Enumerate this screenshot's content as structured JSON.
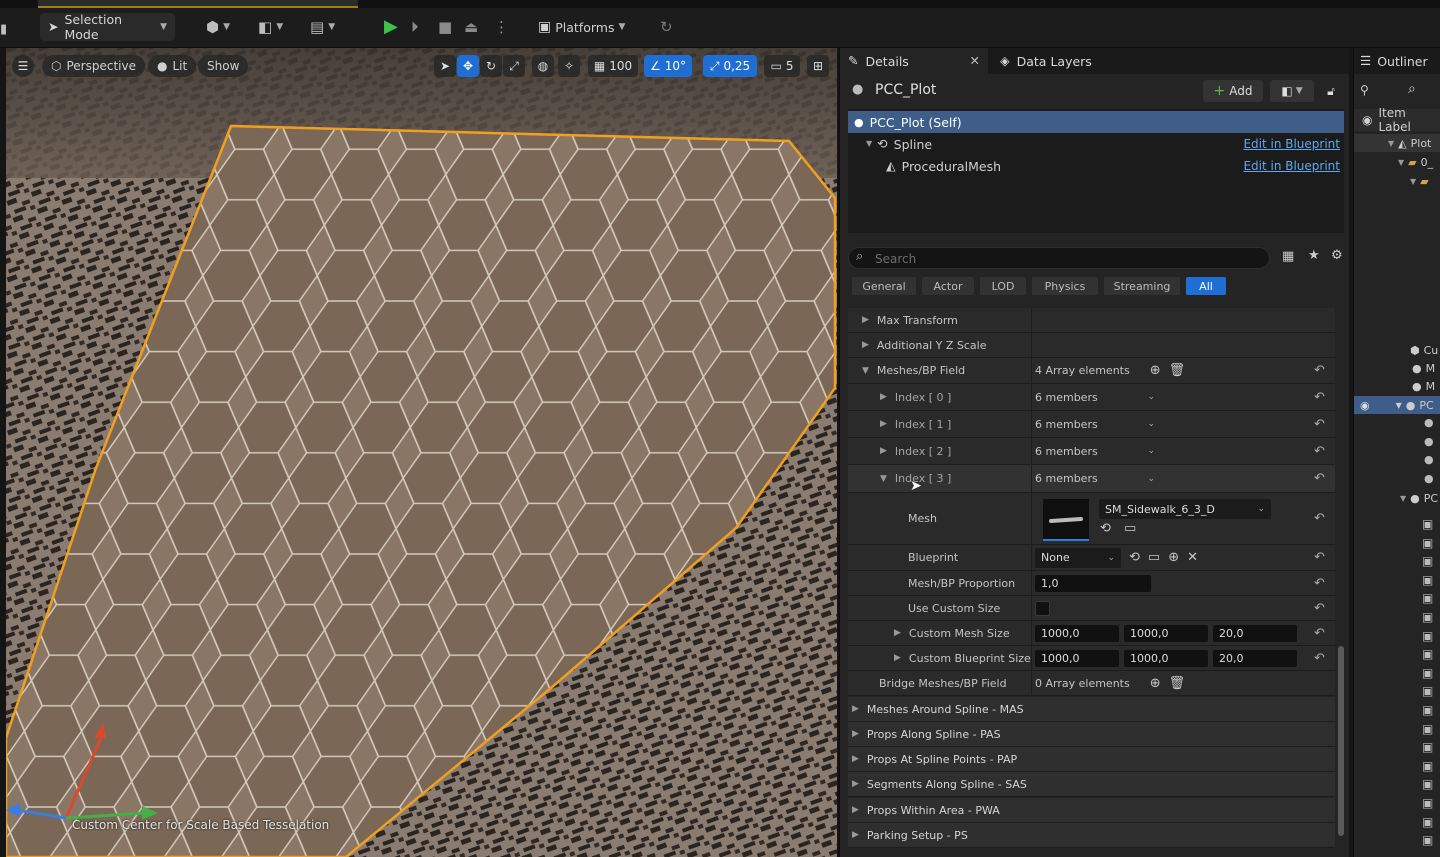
{
  "toolbar": {
    "selection_mode": "Selection Mode",
    "platforms": "Platforms",
    "icons": [
      "save-icon",
      "add-actor-icon",
      "blueprint-icon",
      "cinematics-icon",
      "play-icon",
      "step-icon",
      "stop-icon",
      "eject-icon",
      "more-icon",
      "platforms-icon",
      "refresh-icon"
    ]
  },
  "viewport": {
    "perspective": "Perspective",
    "lit": "Lit",
    "show": "Show",
    "grid_size": "100",
    "rotation_snap": "10°",
    "scale_snap": "0,25",
    "camera_speed": "5",
    "caption": "Custom Center for Scale Based Tesselation",
    "selection_color": "#f0a020"
  },
  "details": {
    "tab_details": "Details",
    "tab_data_layers": "Data Layers",
    "actor_name": "PCC_Plot",
    "add_label": "Add",
    "components": [
      {
        "label": "PCC_Plot (Self)",
        "link": ""
      },
      {
        "label": "Spline",
        "link": "Edit in Blueprint"
      },
      {
        "label": "ProceduralMesh",
        "link": "Edit in Blueprint"
      }
    ],
    "search_placeholder": "Search",
    "filters": [
      "General",
      "Actor",
      "LOD",
      "Physics",
      "Streaming",
      "All"
    ],
    "rows": {
      "max_transform": "Max Transform",
      "additional_yz_scale": "Additional Y Z Scale",
      "meshes_field": "Meshes/BP Field",
      "meshes_field_count": "4 Array elements",
      "index0": "Index [ 0 ]",
      "index1": "Index [ 1 ]",
      "index2": "Index [ 2 ]",
      "index3": "Index [ 3 ]",
      "members": "6 members",
      "mesh": "Mesh",
      "mesh_value": "SM_Sidewalk_6_3_D",
      "blueprint": "Blueprint",
      "blueprint_value": "None",
      "proportion": "Mesh/BP Proportion",
      "proportion_value": "1,0",
      "use_custom_size": "Use Custom Size",
      "custom_mesh_size": "Custom Mesh Size",
      "custom_bp_size": "Custom Blueprint Size",
      "size_x": "1000,0",
      "size_y": "1000,0",
      "size_z": "20,0",
      "bridge_field": "Bridge Meshes/BP Field",
      "bridge_count": "0 Array elements"
    },
    "categories": [
      "Meshes Around Spline - MAS",
      "Props Along Spline - PAS",
      "Props At Spline Points - PAP",
      "Segments Along Spline - SAS",
      "Props Within Area - PWA",
      "Parking Setup - PS"
    ]
  },
  "outliner": {
    "title": "Outliner",
    "column": "Item Label",
    "items": [
      "Plot",
      "0_",
      "Cu",
      "M",
      "M",
      "PC",
      "PC"
    ]
  }
}
